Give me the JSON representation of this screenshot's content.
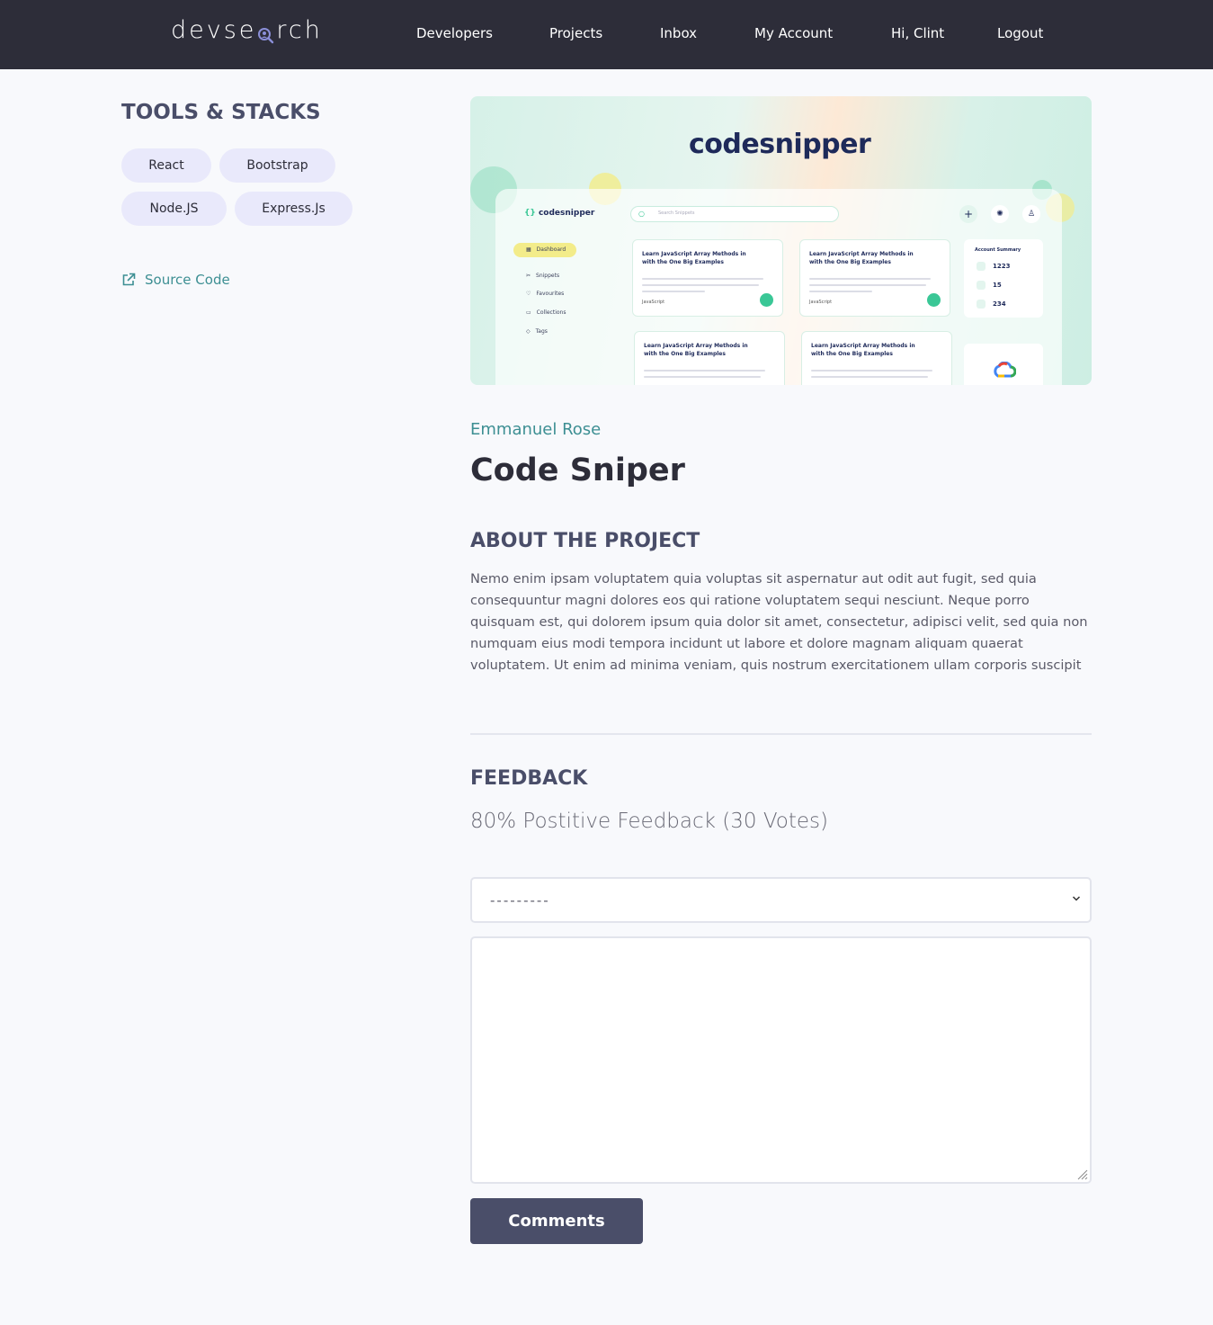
{
  "header": {
    "logo_text": "devsearch",
    "nav": [
      {
        "label": "Developers"
      },
      {
        "label": "Projects"
      },
      {
        "label": "Inbox"
      },
      {
        "label": "My Account"
      },
      {
        "label": "Hi, Clint"
      },
      {
        "label": "Logout"
      }
    ]
  },
  "sidebar": {
    "title": "TOOLS & STACKS",
    "tags": [
      "React",
      "Bootstrap",
      "Node.JS",
      "Express.Js"
    ],
    "source_code_label": "Source Code"
  },
  "thumbnail": {
    "brand": "codesnipper",
    "search_placeholder": "Search Snippets",
    "menu": [
      "Dashboard",
      "Snippets",
      "Favourites",
      "Collections",
      "Tags"
    ],
    "card_title": "Learn JavaScript Array Methods in with the One Big Examples",
    "card_tag": "JavaScript",
    "summary_title": "Account Summary",
    "summary_values": [
      "1223",
      "15",
      "234"
    ]
  },
  "project": {
    "author": "Emmanuel Rose",
    "title": "Code Sniper",
    "about_title": "ABOUT THE PROJECT",
    "about_text": "Nemo enim ipsam voluptatem quia voluptas sit aspernatur aut odit aut fugit, sed quia consequuntur magni dolores eos qui ratione voluptatem sequi nesciunt. Neque porro quisquam est, qui dolorem ipsum quia dolor sit amet, consectetur, adipisci velit, sed quia non numquam eius modi tempora incidunt ut labore et dolore magnam aliquam quaerat voluptatem. Ut enim ad minima veniam, quis nostrum exercitationem ullam corporis suscipit"
  },
  "feedback": {
    "title": "FEEDBACK",
    "vote_summary": "80% Postitive Feedback (30 Votes)",
    "select_value": "---------",
    "comment_value": "",
    "submit_label": "Comments"
  },
  "colors": {
    "header_bg": "#2d2d39",
    "accent": "#3d8f93",
    "heading": "#4a4e69",
    "tag_bg": "#e9e9fb",
    "button_bg": "#4a4e69"
  }
}
